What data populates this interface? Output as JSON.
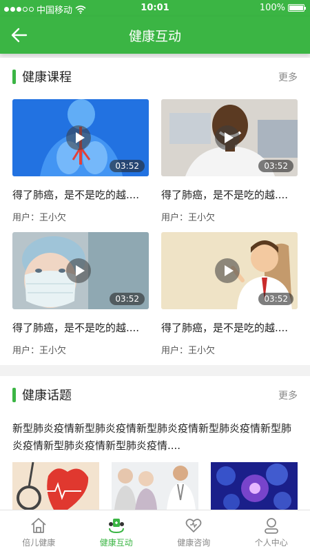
{
  "status": {
    "carrier": "中国移动",
    "time": "10:01",
    "battery": "100%"
  },
  "nav": {
    "title": "健康互动"
  },
  "courses": {
    "title": "健康课程",
    "more": "更多",
    "items": [
      {
        "title": "得了肺癌，是不是吃的越....",
        "user": "用户：王小欠",
        "duration": "03:52"
      },
      {
        "title": "得了肺癌，是不是吃的越....",
        "user": "用户：王小欠",
        "duration": "03:52"
      },
      {
        "title": "得了肺癌，是不是吃的越....",
        "user": "用户：王小欠",
        "duration": "03:52"
      },
      {
        "title": "得了肺癌，是不是吃的越....",
        "user": "用户：王小欠",
        "duration": "03:52"
      }
    ]
  },
  "topics": {
    "title": "健康话题",
    "more": "更多",
    "text": "新型肺炎疫情新型肺炎疫情新型肺炎疫情新型肺炎疫情新型肺炎疫情新型肺炎疫情新型肺炎疫情...."
  },
  "tabs": [
    {
      "label": "倍儿健康"
    },
    {
      "label": "健康互动"
    },
    {
      "label": "健康咨询"
    },
    {
      "label": "个人中心"
    }
  ],
  "colors": {
    "brand": "#3bb544"
  }
}
